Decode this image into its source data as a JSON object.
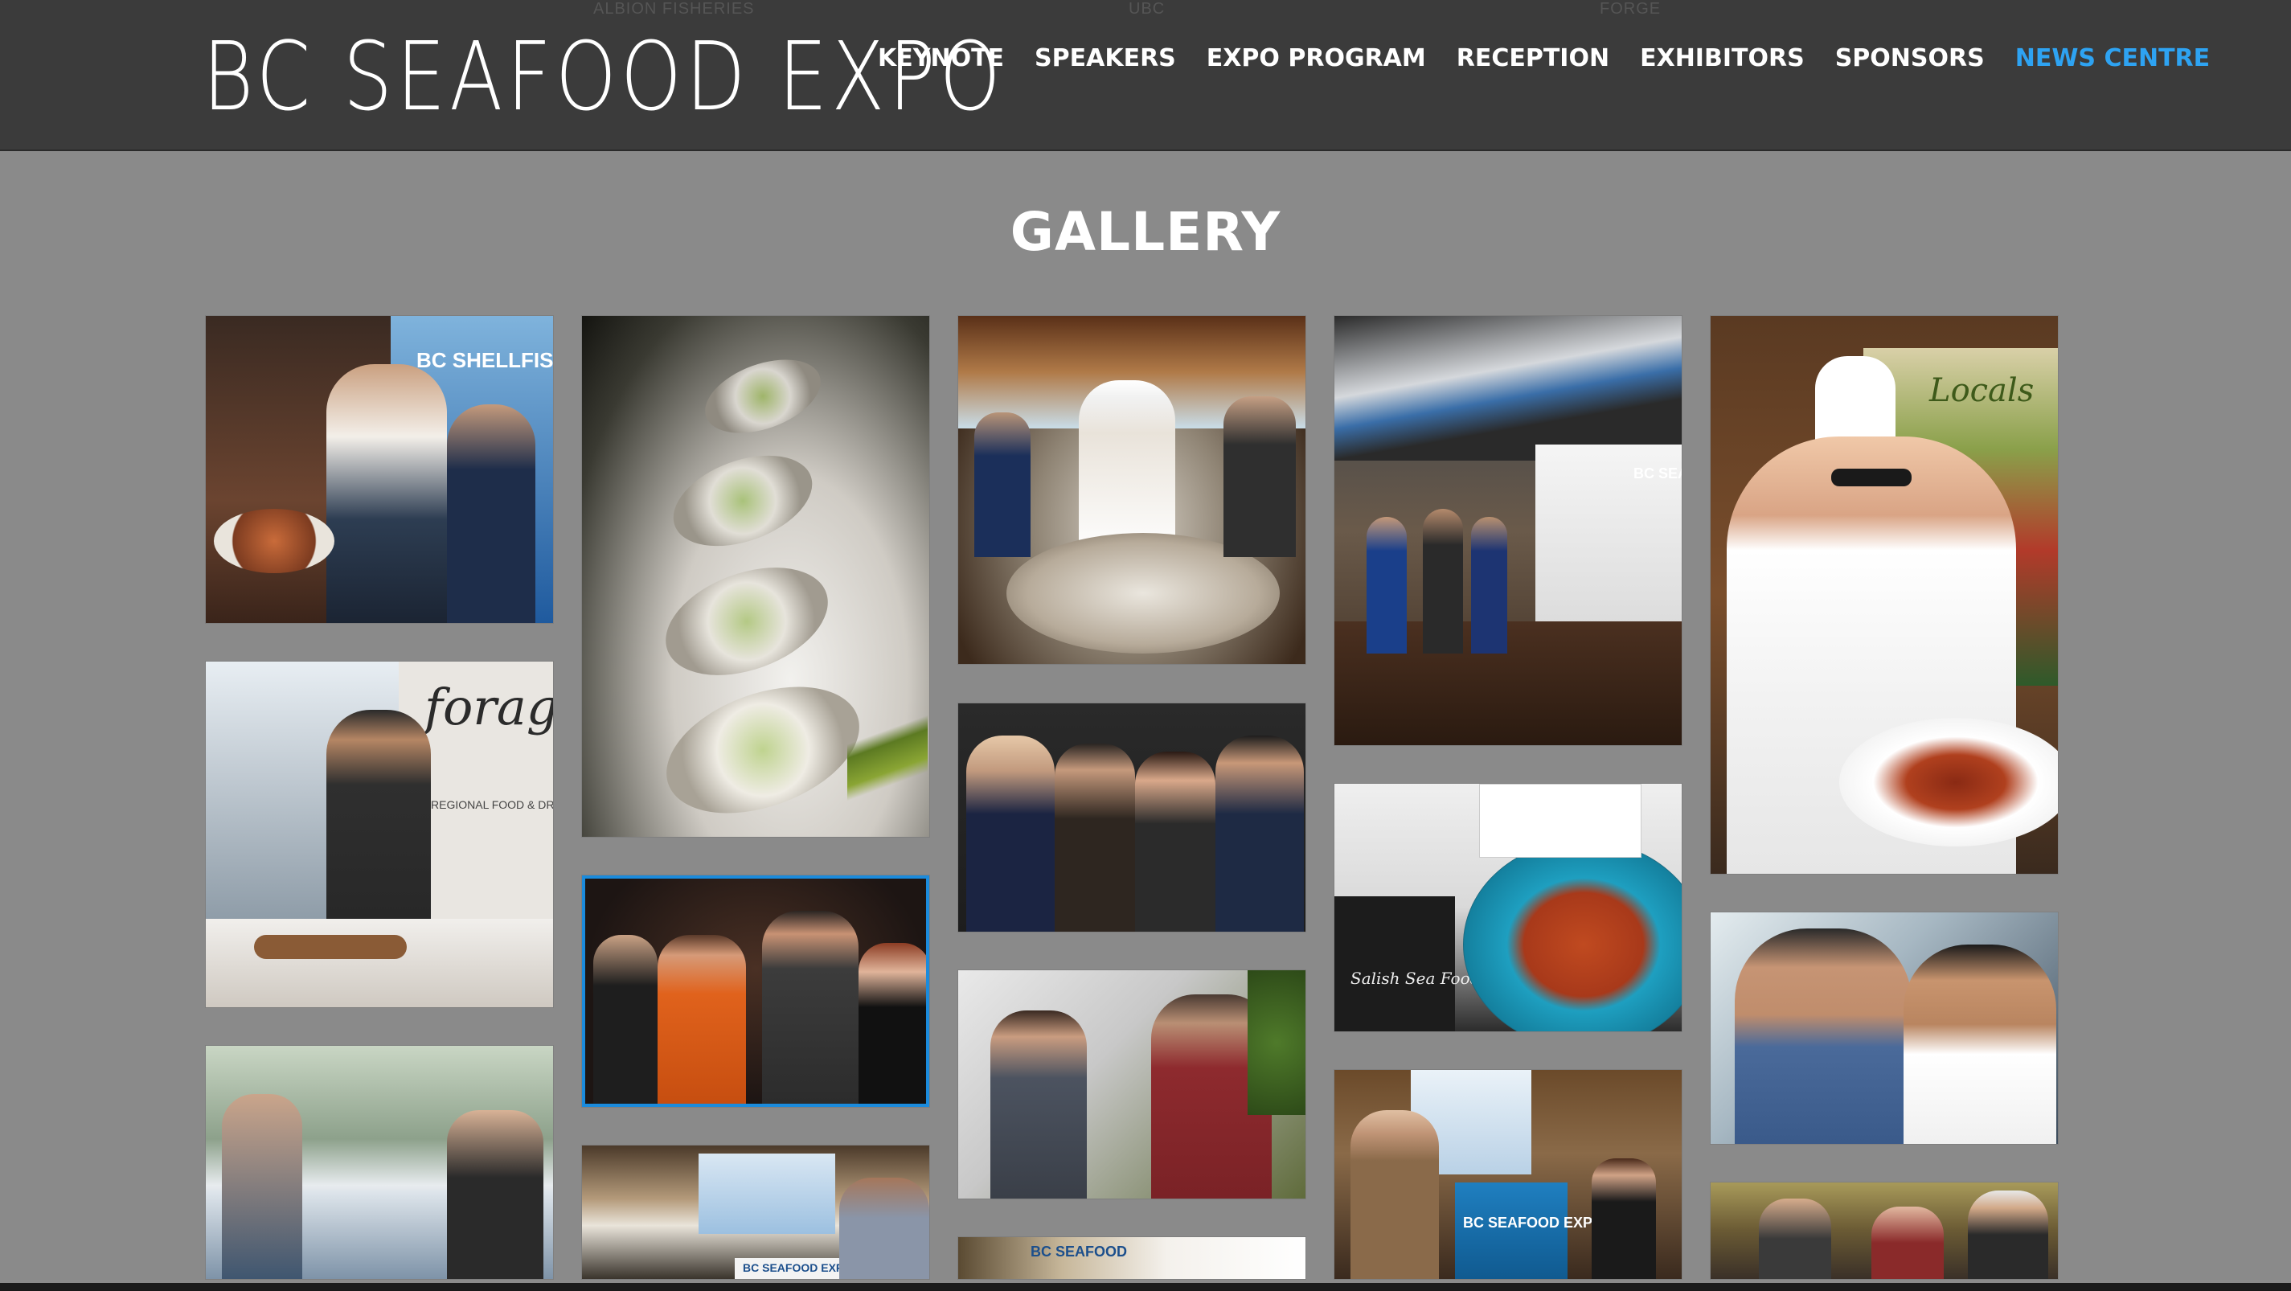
{
  "header": {
    "logo": "BC SEAFOOD EXPO",
    "ghost_texts": [
      "ALBION FISHERIES",
      "UBC",
      "FORGE"
    ],
    "nav": [
      {
        "label": "KEYNOTE",
        "active": false
      },
      {
        "label": "SPEAKERS",
        "active": false
      },
      {
        "label": "EXPO PROGRAM",
        "active": false
      },
      {
        "label": "RECEPTION",
        "active": false
      },
      {
        "label": "EXHIBITORS",
        "active": false
      },
      {
        "label": "SPONSORS",
        "active": false
      },
      {
        "label": "NEWS CENTRE",
        "active": true
      }
    ]
  },
  "main": {
    "title": "GALLERY"
  },
  "gallery": {
    "photo_texts": {
      "shellfish_banner": "BC SHELLFISH &",
      "forage_sign": "forage",
      "forage_sub": "REGIONAL FOOD & DRINK",
      "bc_seafood_banner": "BC SEA",
      "locals_sign": "Locals",
      "podium": "BC SEAFOOD EXPO",
      "bc_seafood_table": "BC SEAFOOD EXPO",
      "seafood_sign": "BC SEAFOOD",
      "salish_label": "Salish Sea Foods"
    }
  },
  "colors": {
    "header_bg": "#3b3b3b",
    "page_bg": "#8a8a8a",
    "nav_text": "#ffffff",
    "nav_active": "#2ea3f2"
  }
}
